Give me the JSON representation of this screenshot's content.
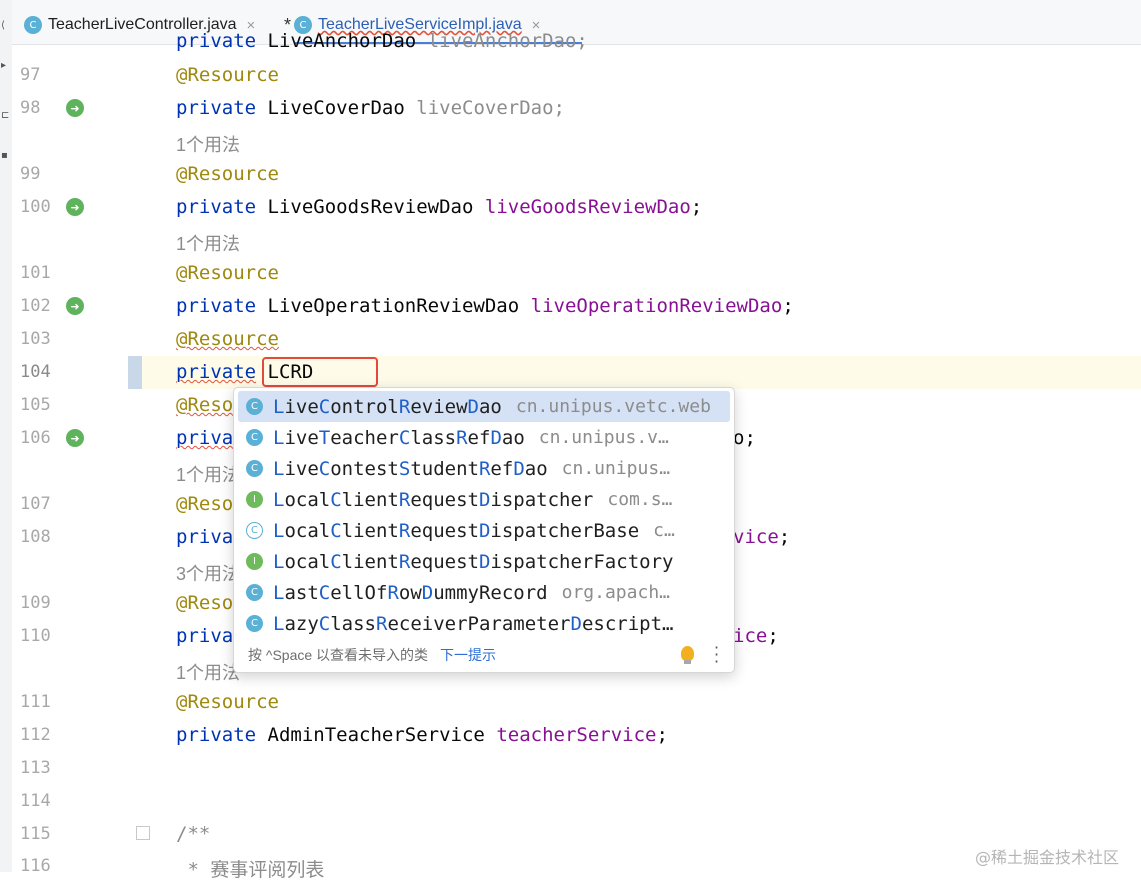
{
  "tabs": [
    {
      "label": "TeacherLiveController.java",
      "icon": "class-c-icon",
      "close": "×",
      "modified": false
    },
    {
      "label": "TeacherLiveServiceImpl.java",
      "icon": "class-c-icon",
      "close": "×",
      "modified": true,
      "modified_mark": "*"
    }
  ],
  "editor": {
    "typed_text": "LCRD",
    "line_numbers": [
      "97",
      "98",
      "99",
      "100",
      "101",
      "102",
      "103",
      "104",
      "105",
      "106",
      "107",
      "108",
      "109",
      "110",
      "111",
      "112",
      "113",
      "114",
      "115",
      "116"
    ],
    "top_partial": {
      "kw": "private",
      "type": "LiveAnchorDao",
      "field": "liveAnchorDao;"
    },
    "lines": {
      "l97": "@Resource",
      "l98_kw": "private",
      "l98_type": "LiveCoverDao",
      "l98_field": "liveCoverDao;",
      "hint1": "1个用法",
      "l99": "@Resource",
      "l100_kw": "private",
      "l100_type": "LiveGoodsReviewDao",
      "l100_field": "liveGoodsReviewDao",
      "l100_end": ";",
      "hint2": "1个用法",
      "l101": "@Resource",
      "l102_kw": "private",
      "l102_type": "LiveOperationReviewDao",
      "l102_field": "liveOperationReviewDao",
      "l102_end": ";",
      "l103": "@Resource",
      "l104_kw": "private",
      "l105": "@Reso",
      "l106_kw": "priva",
      "l106_tail": "o;",
      "hint3": "1个用法",
      "l107": "@Reso",
      "l108_kw": "privat",
      "l108_tail": "vice",
      "l108_end": ";",
      "hint4": "3个用法",
      "l109": "@Reso",
      "l110_kw": "priva",
      "l110_tail": "ice",
      "l110_end": ";",
      "hint5": "1个用法",
      "l111": "@Resource",
      "l112_kw": "private",
      "l112_type": "AdminTeacherService",
      "l112_field": "teacherService",
      "l112_end": ";",
      "l115": "/**",
      "l116": " * 赛事评阅列表"
    }
  },
  "completion": {
    "items": [
      {
        "name_parts": [
          "L",
          "ive",
          "C",
          "ontrol",
          "R",
          "eview",
          "D",
          "ao"
        ],
        "pkg": "cn.unipus.vetc.web",
        "kind": "class",
        "icon": "class-c-icon",
        "selected": true
      },
      {
        "name_parts": [
          "L",
          "ive",
          "T",
          "eacher",
          "C",
          "lass",
          "R",
          "ef",
          "D",
          "ao"
        ],
        "pkg": "cn.unipus.v…",
        "kind": "class",
        "icon": "class-c-icon",
        "selected": false,
        "hl": [
          0,
          4,
          6,
          8
        ]
      },
      {
        "name_parts": [
          "L",
          "ive",
          "C",
          "ontest",
          "S",
          "tudent",
          "R",
          "ef",
          "D",
          "ao"
        ],
        "pkg": "cn.unipus…",
        "kind": "class",
        "icon": "class-c-icon",
        "selected": false
      },
      {
        "name_parts": [
          "L",
          "ocal",
          "C",
          "lient",
          "R",
          "equest",
          "D",
          "ispatcher"
        ],
        "pkg": "com.s…",
        "kind": "interface",
        "icon": "interface-i-icon",
        "selected": false
      },
      {
        "name_parts": [
          "L",
          "ocal",
          "C",
          "lient",
          "R",
          "equest",
          "D",
          "ispatcherBase"
        ],
        "pkg": "c…",
        "kind": "abstract-class",
        "icon": "abstract-class-icon",
        "selected": false
      },
      {
        "name_parts": [
          "L",
          "ocal",
          "C",
          "lient",
          "R",
          "equest",
          "D",
          "ispatcherFactory"
        ],
        "pkg": "",
        "kind": "interface",
        "icon": "interface-i-icon",
        "selected": false
      },
      {
        "name_parts": [
          "L",
          "ast",
          "C",
          "ellOf",
          "R",
          "ow",
          "D",
          "ummyRecord"
        ],
        "pkg": "org.apach…",
        "kind": "class",
        "icon": "class-c-icon",
        "selected": false
      },
      {
        "name_parts": [
          "L",
          "azy",
          "C",
          "lass",
          "R",
          "eceiverParameter",
          "D",
          "escript…"
        ],
        "pkg": "",
        "kind": "class",
        "icon": "class-c-icon",
        "selected": false
      }
    ],
    "footer_hint": "按 ^Space 以查看未导入的类",
    "footer_link": "下一提示",
    "icons": [
      "lightbulb-icon",
      "more-vertical-icon"
    ]
  },
  "watermark": "@稀土掘金技术社区",
  "colors": {
    "keyword": "#0033b3",
    "annotation": "#9e880d",
    "field": "#871094",
    "selection": "#d5e1f4",
    "highlight_box": "#e5483d"
  }
}
